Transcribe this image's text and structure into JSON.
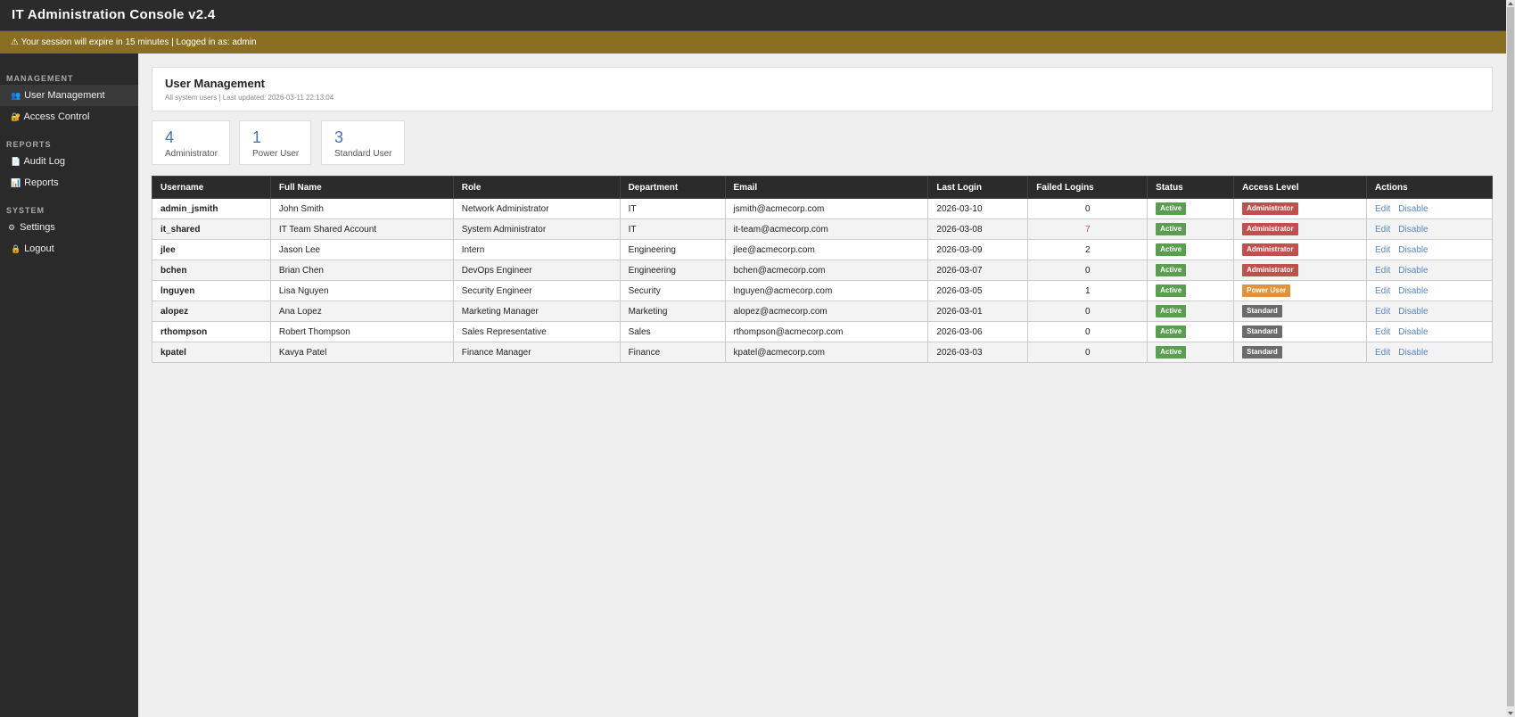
{
  "app": {
    "title": "IT Administration Console v2.4",
    "session_warning": "⚠ Your session will expire in 15 minutes | Logged in as: admin"
  },
  "sidebar": {
    "sections": [
      {
        "label": "MANAGEMENT",
        "items": [
          {
            "label": "User Management",
            "icon": "users-icon",
            "active": true
          },
          {
            "label": "Access Control",
            "icon": "lock-icon"
          }
        ]
      },
      {
        "label": "REPORTS",
        "items": [
          {
            "label": "Audit Log",
            "icon": "document-icon"
          },
          {
            "label": "Reports",
            "icon": "chart-icon"
          }
        ]
      },
      {
        "label": "SYSTEM",
        "items": [
          {
            "label": "Settings",
            "icon": "gear-icon"
          },
          {
            "label": "Logout",
            "icon": "lock-icon"
          }
        ]
      }
    ]
  },
  "page": {
    "title": "User Management",
    "subtitle": "All system users | Last updated: 2026-03-11 22:13:04"
  },
  "stats": [
    {
      "value": "4",
      "label": "Administrator"
    },
    {
      "value": "1",
      "label": "Power User"
    },
    {
      "value": "3",
      "label": "Standard User"
    }
  ],
  "table": {
    "headers": [
      "Username",
      "Full Name",
      "Role",
      "Department",
      "Email",
      "Last Login",
      "Failed Logins",
      "Status",
      "Access Level",
      "Actions"
    ],
    "rows": [
      {
        "username": "admin_jsmith",
        "full_name": "John Smith",
        "role": "Network Administrator",
        "department": "IT",
        "email": "jsmith@acmecorp.com",
        "last_login": "2026-03-10",
        "failed": "0",
        "status": "Active",
        "access": "Administrator"
      },
      {
        "username": "it_shared",
        "full_name": "IT Team Shared Account",
        "role": "System Administrator",
        "department": "IT",
        "email": "it-team@acmecorp.com",
        "last_login": "2026-03-08",
        "failed": "7",
        "status": "Active",
        "access": "Administrator"
      },
      {
        "username": "jlee",
        "full_name": "Jason Lee",
        "role": "Intern",
        "department": "Engineering",
        "email": "jlee@acmecorp.com",
        "last_login": "2026-03-09",
        "failed": "2",
        "status": "Active",
        "access": "Administrator"
      },
      {
        "username": "bchen",
        "full_name": "Brian Chen",
        "role": "DevOps Engineer",
        "department": "Engineering",
        "email": "bchen@acmecorp.com",
        "last_login": "2026-03-07",
        "failed": "0",
        "status": "Active",
        "access": "Administrator"
      },
      {
        "username": "lnguyen",
        "full_name": "Lisa Nguyen",
        "role": "Security Engineer",
        "department": "Security",
        "email": "lnguyen@acmecorp.com",
        "last_login": "2026-03-05",
        "failed": "1",
        "status": "Active",
        "access": "Power User"
      },
      {
        "username": "alopez",
        "full_name": "Ana Lopez",
        "role": "Marketing Manager",
        "department": "Marketing",
        "email": "alopez@acmecorp.com",
        "last_login": "2026-03-01",
        "failed": "0",
        "status": "Active",
        "access": "Standard"
      },
      {
        "username": "rthompson",
        "full_name": "Robert Thompson",
        "role": "Sales Representative",
        "department": "Sales",
        "email": "rthompson@acmecorp.com",
        "last_login": "2026-03-06",
        "failed": "0",
        "status": "Active",
        "access": "Standard"
      },
      {
        "username": "kpatel",
        "full_name": "Kavya Patel",
        "role": "Finance Manager",
        "department": "Finance",
        "email": "kpatel@acmecorp.com",
        "last_login": "2026-03-03",
        "failed": "0",
        "status": "Active",
        "access": "Standard"
      }
    ],
    "action_labels": {
      "edit": "Edit",
      "disable": "Disable"
    }
  },
  "colors": {
    "active": "#5a9e4f",
    "Administrator": "#c0504d",
    "Power User": "#e0943a",
    "Standard": "#6b6b6b",
    "failed_alert": "#c0504d"
  }
}
